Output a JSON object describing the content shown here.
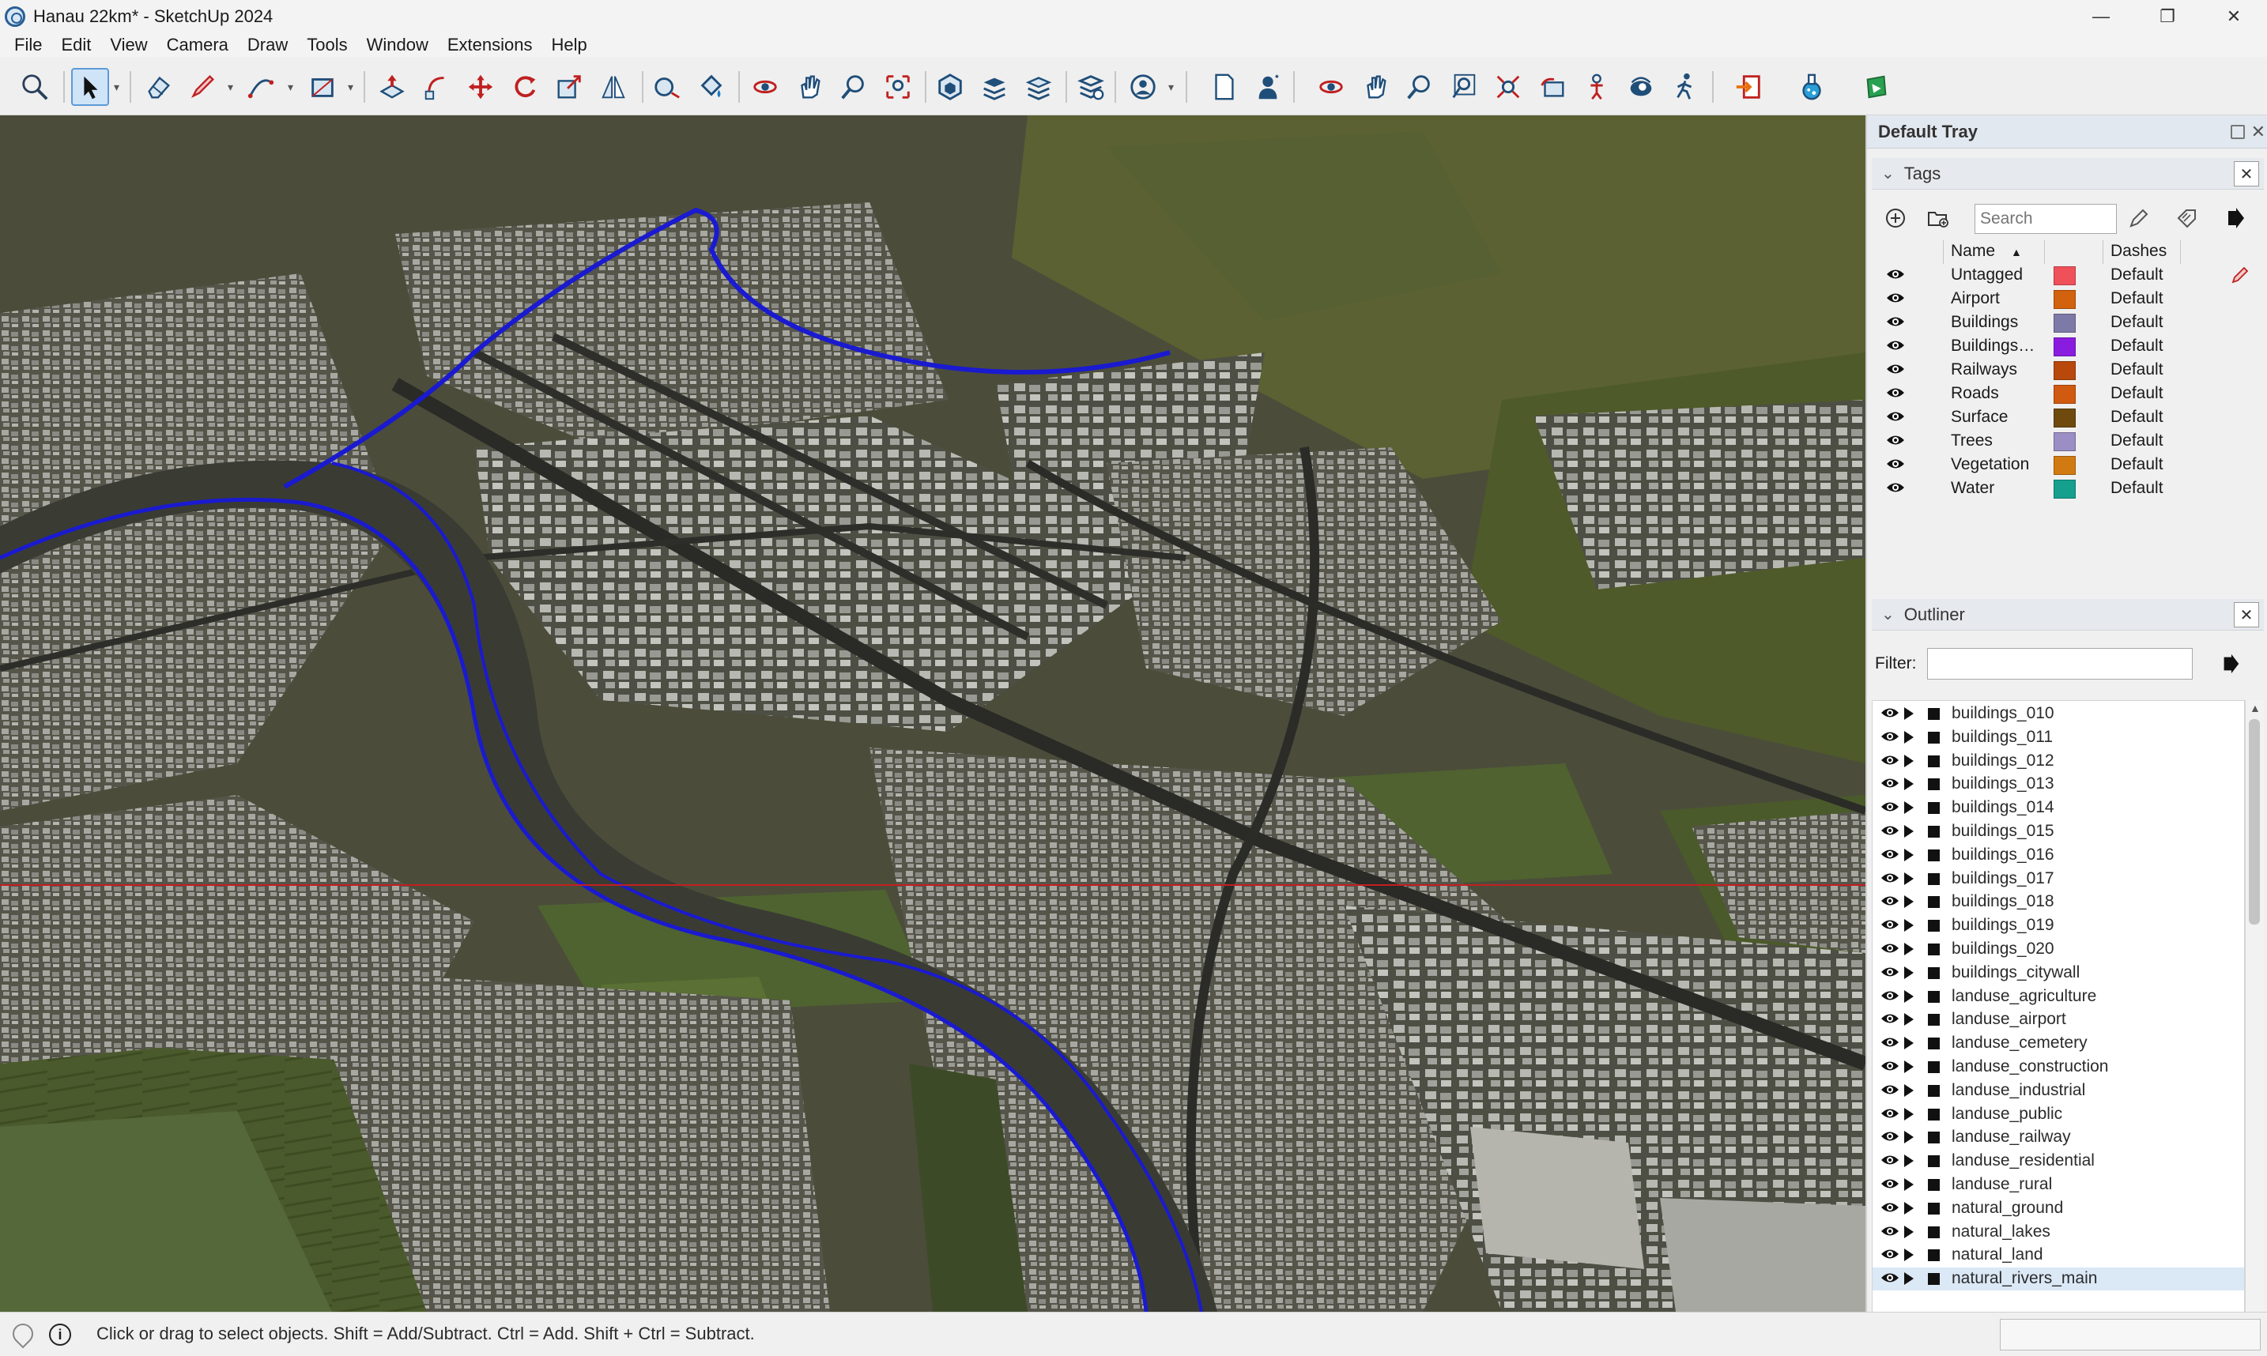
{
  "window": {
    "title": "Hanau 22km* - SketchUp 2024",
    "controls": {
      "minimize": "—",
      "restore": "❐",
      "close": "✕"
    }
  },
  "menu": [
    "File",
    "Edit",
    "View",
    "Camera",
    "Draw",
    "Tools",
    "Window",
    "Extensions",
    "Help"
  ],
  "toolbar": {
    "icons": [
      "zoom-extents-icon",
      "select-icon",
      "eraser-icon",
      "pencil-icon",
      "arc-icon",
      "rectangle-icon",
      "push-pull-icon",
      "follow-me-icon",
      "move-icon",
      "rotate-icon",
      "scale-icon",
      "flip-icon",
      "tape-measure-icon",
      "paint-bucket-icon",
      "orbit-icon",
      "pan-icon",
      "zoom-icon",
      "zoom-window-icon",
      "components-icon",
      "layers-icon",
      "materials-icon",
      "styles-icon",
      "profile-icon",
      "new-file-icon",
      "user-icon",
      "orbit-icon-2",
      "pan-icon-2",
      "zoom-icon-2",
      "zoom-box-icon",
      "zoom-extents-icon-2",
      "previous-view-icon",
      "position-camera-icon",
      "look-around-icon",
      "walk-icon",
      "export-icon",
      "flask-icon",
      "extension-warehouse-icon"
    ]
  },
  "tray": {
    "title": "Default Tray",
    "tags": {
      "title": "Tags",
      "search_placeholder": "Search",
      "col_name": "Name",
      "col_dashes": "Dashes",
      "rows": [
        {
          "name": "Untagged",
          "color": "#f0505a",
          "dashes": "Default"
        },
        {
          "name": "Airport",
          "color": "#d2620e",
          "dashes": "Default"
        },
        {
          "name": "Buildings",
          "color": "#7e7aa8",
          "dashes": "Default"
        },
        {
          "name": "Buildings…",
          "color": "#8a1ce0",
          "dashes": "Default"
        },
        {
          "name": "Railways",
          "color": "#b8480c",
          "dashes": "Default"
        },
        {
          "name": "Roads",
          "color": "#d05a10",
          "dashes": "Default"
        },
        {
          "name": "Surface",
          "color": "#6e4a0e",
          "dashes": "Default"
        },
        {
          "name": "Trees",
          "color": "#9a8ec4",
          "dashes": "Default"
        },
        {
          "name": "Vegetation",
          "color": "#d27a12",
          "dashes": "Default"
        },
        {
          "name": "Water",
          "color": "#15a08e",
          "dashes": "Default"
        }
      ]
    },
    "outliner": {
      "title": "Outliner",
      "filter_label": "Filter:",
      "filter_value": "",
      "items": [
        "buildings_010",
        "buildings_011",
        "buildings_012",
        "buildings_013",
        "buildings_014",
        "buildings_015",
        "buildings_016",
        "buildings_017",
        "buildings_018",
        "buildings_019",
        "buildings_020",
        "buildings_citywall",
        "landuse_agriculture",
        "landuse_airport",
        "landuse_cemetery",
        "landuse_construction",
        "landuse_industrial",
        "landuse_public",
        "landuse_railway",
        "landuse_residential",
        "landuse_rural",
        "natural_ground",
        "natural_lakes",
        "natural_land",
        "natural_rivers_main"
      ],
      "selected": "natural_rivers_main"
    }
  },
  "status": {
    "text": "Click or drag to select objects. Shift = Add/Subtract. Ctrl = Add. Shift + Ctrl = Subtract."
  },
  "colors": {
    "river": "#1a1ad0",
    "terrain": "#4b4d3d",
    "axis": "#c02020"
  }
}
